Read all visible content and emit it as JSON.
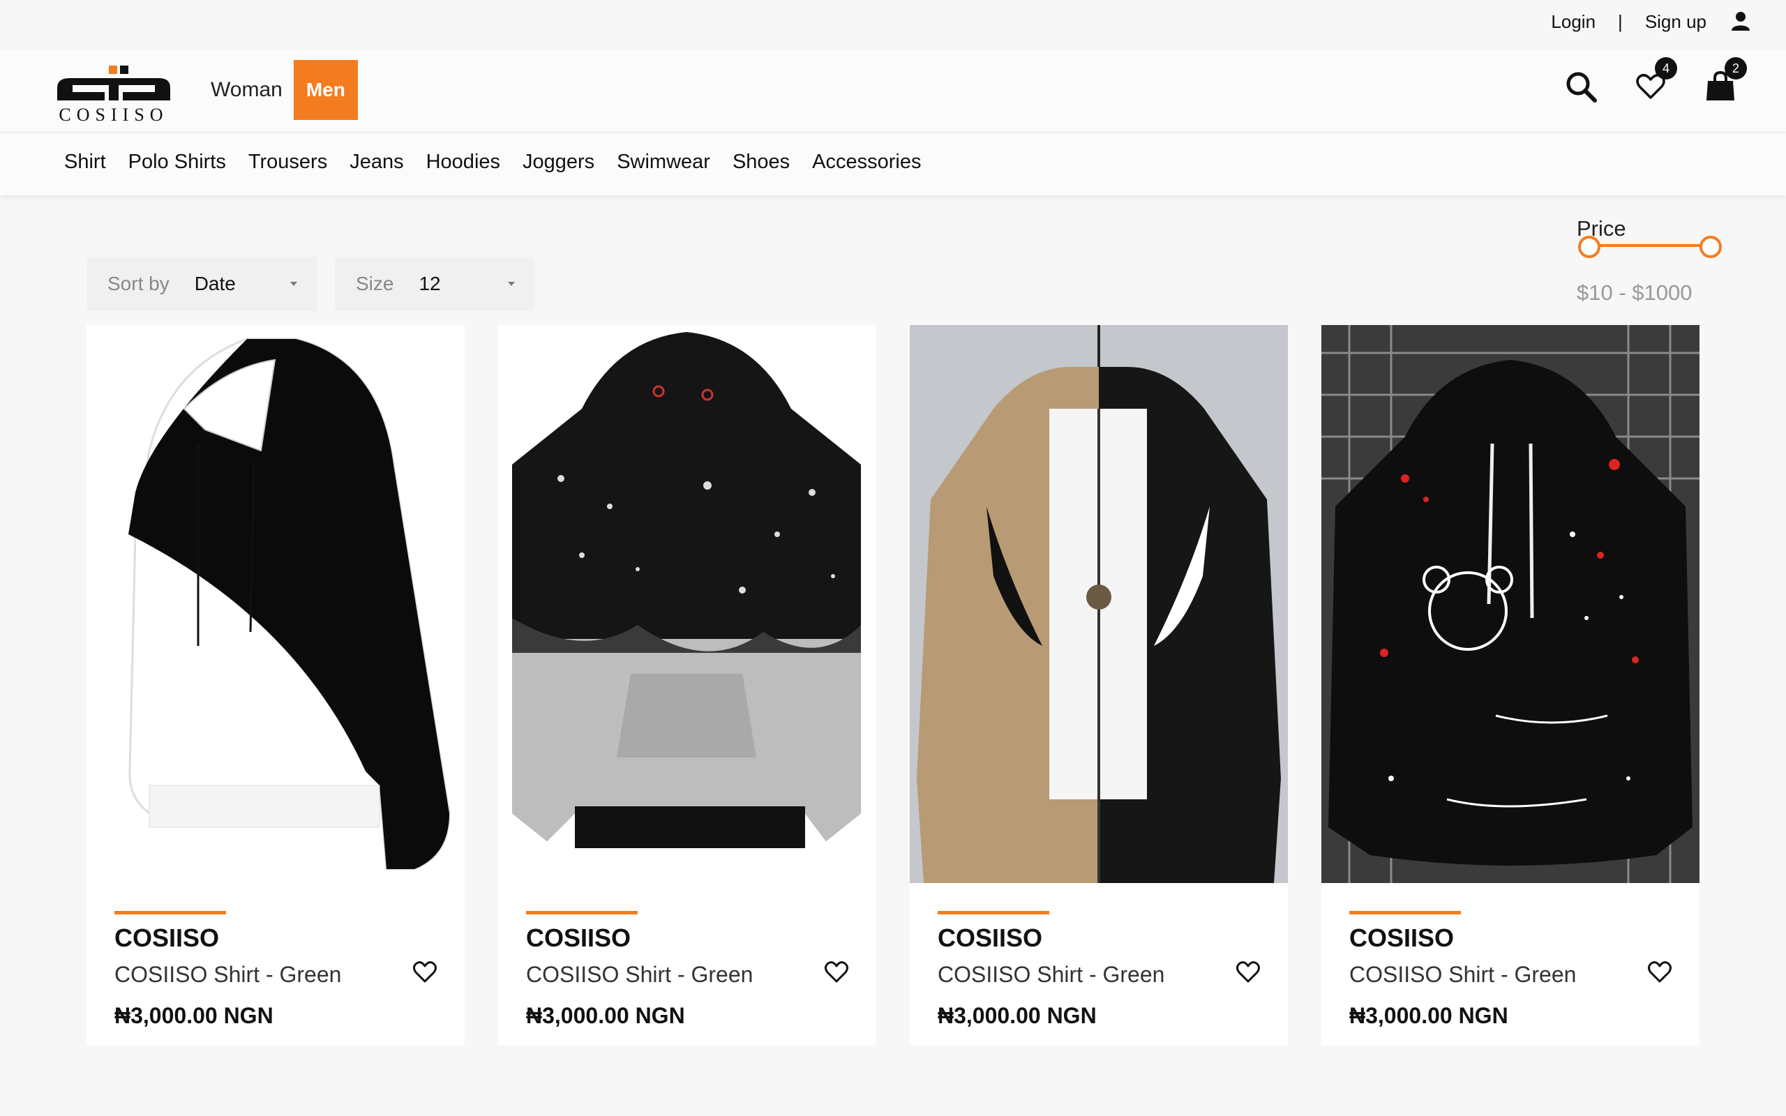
{
  "auth": {
    "login": "Login",
    "separator": "|",
    "signup": "Sign up"
  },
  "brand": {
    "logo_text": "COSIISO"
  },
  "gender": {
    "woman": "Woman",
    "men": "Men"
  },
  "header_icons": {
    "wishlist_count": "4",
    "cart_count": "2"
  },
  "categories": [
    "Shirt",
    "Polo Shirts",
    "Trousers",
    "Jeans",
    "Hoodies",
    "Joggers",
    "Swimwear",
    "Shoes",
    "Accessories"
  ],
  "filters": {
    "sort": {
      "label": "Sort by",
      "value": "Date"
    },
    "size": {
      "label": "Size",
      "value": "12"
    }
  },
  "price": {
    "title": "Price",
    "range": "$10 - $1000"
  },
  "products": [
    {
      "brand": "COSIISO",
      "title": "COSIISO Shirt - Green",
      "price": "₦3,000.00 NGN"
    },
    {
      "brand": "COSIISO",
      "title": "COSIISO Shirt - Green",
      "price": "₦3,000.00 NGN"
    },
    {
      "brand": "COSIISO",
      "title": "COSIISO Shirt - Green",
      "price": "₦3,000.00 NGN"
    },
    {
      "brand": "COSIISO",
      "title": "COSIISO Shirt - Green",
      "price": "₦3,000.00 NGN"
    }
  ],
  "colors": {
    "accent": "#f47c20",
    "text": "#111111",
    "muted": "#999999"
  }
}
